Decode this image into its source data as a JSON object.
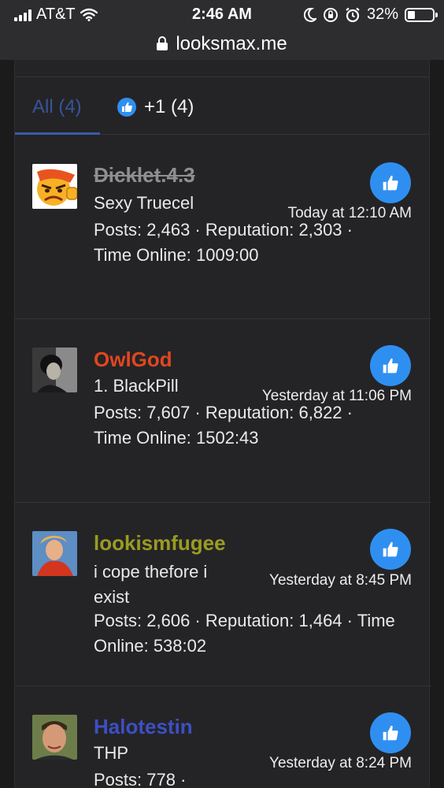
{
  "status_bar": {
    "carrier": "AT&T",
    "time": "2:46 AM",
    "battery": "32%"
  },
  "browser": {
    "url": "looksmax.me"
  },
  "tabs": {
    "all_label": "All (4)",
    "like_label": "+1 (4)"
  },
  "reactions": [
    {
      "username": "Dicklet.4.3",
      "user_title": "Sexy Truecel",
      "stats": "Posts: 2,463 · Reputation: 2,303 · Time Online: 1009:00",
      "date": "Today at 12:10 AM",
      "username_color": "#8f8f93",
      "banned": true
    },
    {
      "username": "OwlGod",
      "user_title": "1. BlackPill",
      "stats": "Posts: 7,607 · Reputation: 6,822 · Time Online: 1502:43",
      "date": "Yesterday at 11:06 PM",
      "username_color": "#e1461f"
    },
    {
      "username": "lookismfugee",
      "user_title": "i cope thefore i exist",
      "stats": "Posts: 2,606 · Reputation: 1,464 · Time Online: 538:02",
      "date": "Yesterday at 8:45 PM",
      "username_color": "#9a9c22"
    },
    {
      "username": "Halotestin",
      "user_title": "THP",
      "stats": "Posts: 778 ·",
      "date": "Yesterday at 8:24 PM",
      "username_color": "#3d4fc4"
    }
  ],
  "icons": {
    "like": "thumbs-up-icon",
    "lock": "lock-icon",
    "wifi": "wifi-icon",
    "moon": "moon-icon",
    "rotation_lock": "rotation-lock-icon",
    "alarm": "alarm-icon"
  }
}
